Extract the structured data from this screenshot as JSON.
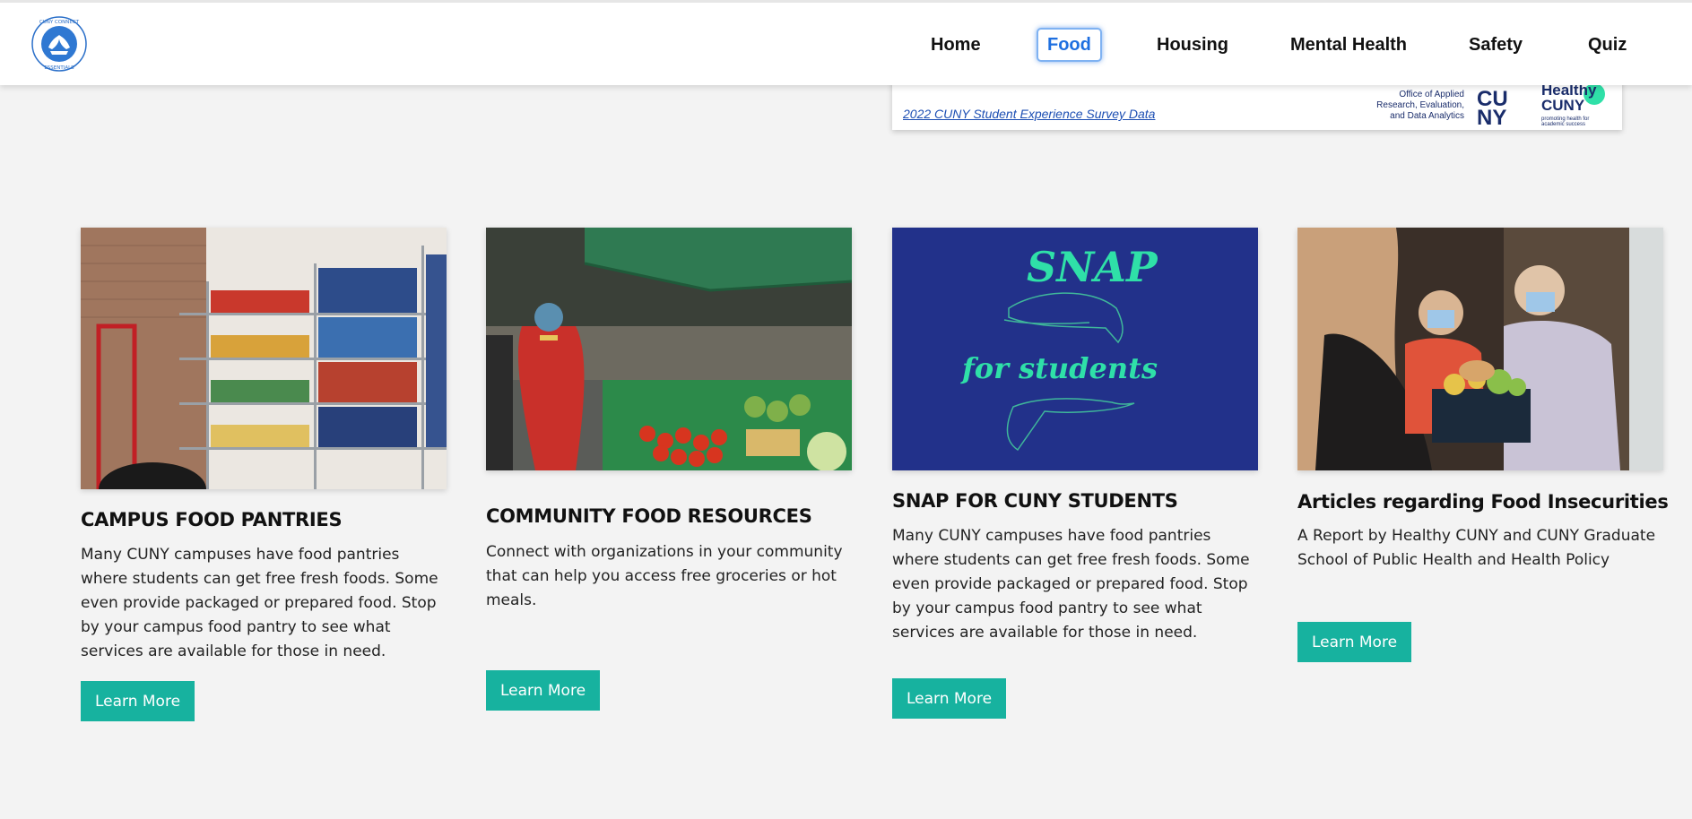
{
  "header": {
    "logo_text": "CUNY CONNECT ESSENTIALS",
    "nav": [
      {
        "label": "Home",
        "active": false
      },
      {
        "label": "Food",
        "active": true
      },
      {
        "label": "Housing",
        "active": false
      },
      {
        "label": "Mental Health",
        "active": false
      },
      {
        "label": "Safety",
        "active": false
      },
      {
        "label": "Quiz",
        "active": false
      }
    ]
  },
  "banner": {
    "link_text": "2022 CUNY Student Experience Survey Data",
    "office_text": "Office of Applied Research, Evaluation, and Data Analytics",
    "cuny_logo_text": "CUNY",
    "healthy_title": "Healthy CUNY",
    "healthy_tagline": "promoting health for academic success"
  },
  "cards": [
    {
      "image": "food-pantry-shelves-photo",
      "title": "CAMPUS FOOD PANTRIES",
      "text": "Many CUNY campuses have food pantries where students can get free fresh foods. Some even provide packaged or prepared food. Stop by your campus food pantry to see what services are available for those in need.",
      "button": "Learn More"
    },
    {
      "image": "outdoor-market-photo",
      "title": "COMMUNITY FOOD RESOURCES",
      "text": "Connect with organizations in your community that can help you access free groceries or hot meals.",
      "button": "Learn More"
    },
    {
      "image": "snap-for-students-graphic",
      "image_text_1": "SNAP",
      "image_text_2": "for students",
      "title": "SNAP FOR CUNY STUDENTS",
      "text": "Many CUNY campuses have food pantries where students can get free fresh foods. Some even provide packaged or prepared food. Stop by your campus food pantry to see what services are available for those in need.",
      "button": "Learn More"
    },
    {
      "image": "volunteers-food-donation-photo",
      "title": "Articles regarding Food Insecurities",
      "text": "A Report by Healthy CUNY and CUNY Graduate School of Public Health and Health Policy",
      "button": "Learn More"
    }
  ],
  "colors": {
    "accent_button": "#17b29f",
    "nav_active": "#1e6fe0",
    "snap_bg": "#22318a",
    "snap_text": "#2fe0a8",
    "page_bg": "#f3f3f3"
  }
}
